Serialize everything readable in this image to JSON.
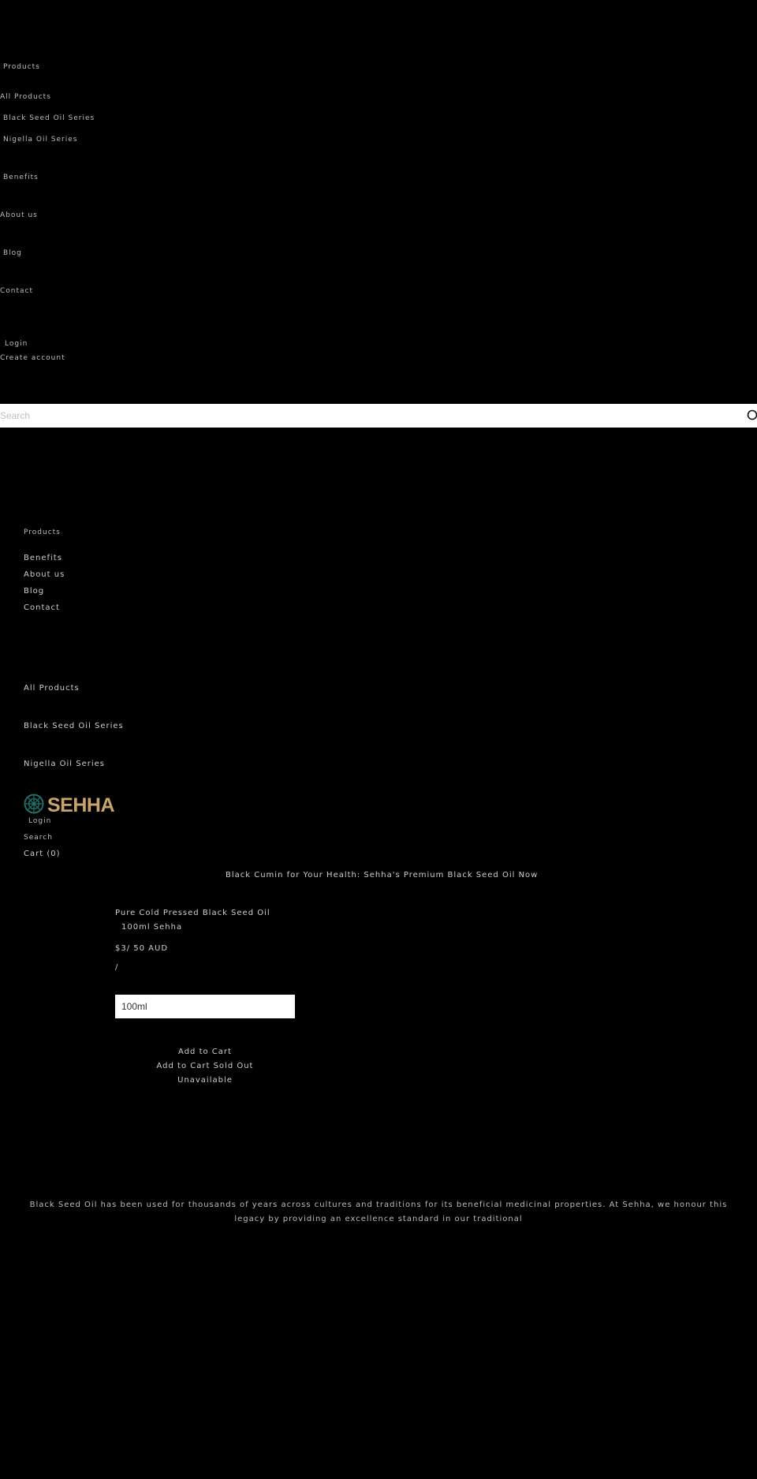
{
  "mobile_menu": {
    "heading": "Products",
    "items": [
      "All Products",
      "Black Seed Oil Series",
      "Nigella Oil Series"
    ],
    "links": [
      "Benefits",
      "About us",
      "Blog",
      "Contact"
    ],
    "login": "Login",
    "create_account": "Create account"
  },
  "search": {
    "placeholder": "Search",
    "icon": "search-icon"
  },
  "header_nav": {
    "products": "Products",
    "links": [
      "Benefits",
      "About us",
      "Blog",
      "Contact"
    ],
    "categories": [
      "All Products",
      "Black Seed Oil Series",
      "Nigella Oil Series"
    ]
  },
  "logo": {
    "word": "SEHHA",
    "icon": "sehha-emblem-icon",
    "colors": {
      "emblem": "#1f6f67",
      "word": "#c9a46a"
    }
  },
  "header_actions": {
    "login": "Login",
    "search": "Search",
    "cart": "Cart (0)"
  },
  "announcement": "Black Cumin for Your Health: Sehha's Premium Black Seed Oil Now",
  "product": {
    "title": "Pure Cold Pressed Black Seed Oil",
    "subtitle": "100ml Sehha",
    "price": "$3/ 50 AUD",
    "price_separator": "/",
    "size_selected": "100ml",
    "add_to_cart": "Add to Cart",
    "add_to_cart_sold_out": "Add to Cart Sold Out",
    "unavailable": "Unavailable"
  },
  "about_text": "Black Seed Oil has been used for thousands of years across cultures and traditions for its beneficial medicinal properties. At Sehha, we honour this legacy by providing an excellence standard in our traditional"
}
